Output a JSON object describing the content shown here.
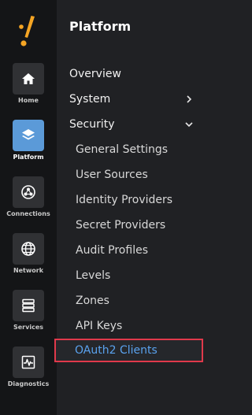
{
  "rail": {
    "items": [
      {
        "label": "Home",
        "icon": "home-icon"
      },
      {
        "label": "Platform",
        "icon": "layers-icon",
        "active": true
      },
      {
        "label": "Connections",
        "icon": "connections-icon"
      },
      {
        "label": "Network",
        "icon": "globe-icon"
      },
      {
        "label": "Services",
        "icon": "server-icon"
      },
      {
        "label": "Diagnostics",
        "icon": "pulse-icon"
      }
    ]
  },
  "panel": {
    "title": "Platform",
    "nav": [
      {
        "label": "Overview"
      },
      {
        "label": "System",
        "chevron": "chevron-right"
      },
      {
        "label": "Security",
        "chevron": "chevron-down",
        "expanded": true
      }
    ],
    "security_items": [
      "General Settings",
      "User Sources",
      "Identity Providers",
      "Secret Providers",
      "Audit Profiles",
      "Levels",
      "Zones",
      "API Keys",
      "OAuth2 Clients"
    ],
    "selected_item": "OAuth2 Clients"
  },
  "colors": {
    "rail_bg": "#141517",
    "panel_bg": "#202124",
    "active_tile": "#5b9ad8",
    "logo_orange": "#f5a524",
    "selected_text": "#5aa2ee",
    "highlight_border": "#e0394b"
  }
}
